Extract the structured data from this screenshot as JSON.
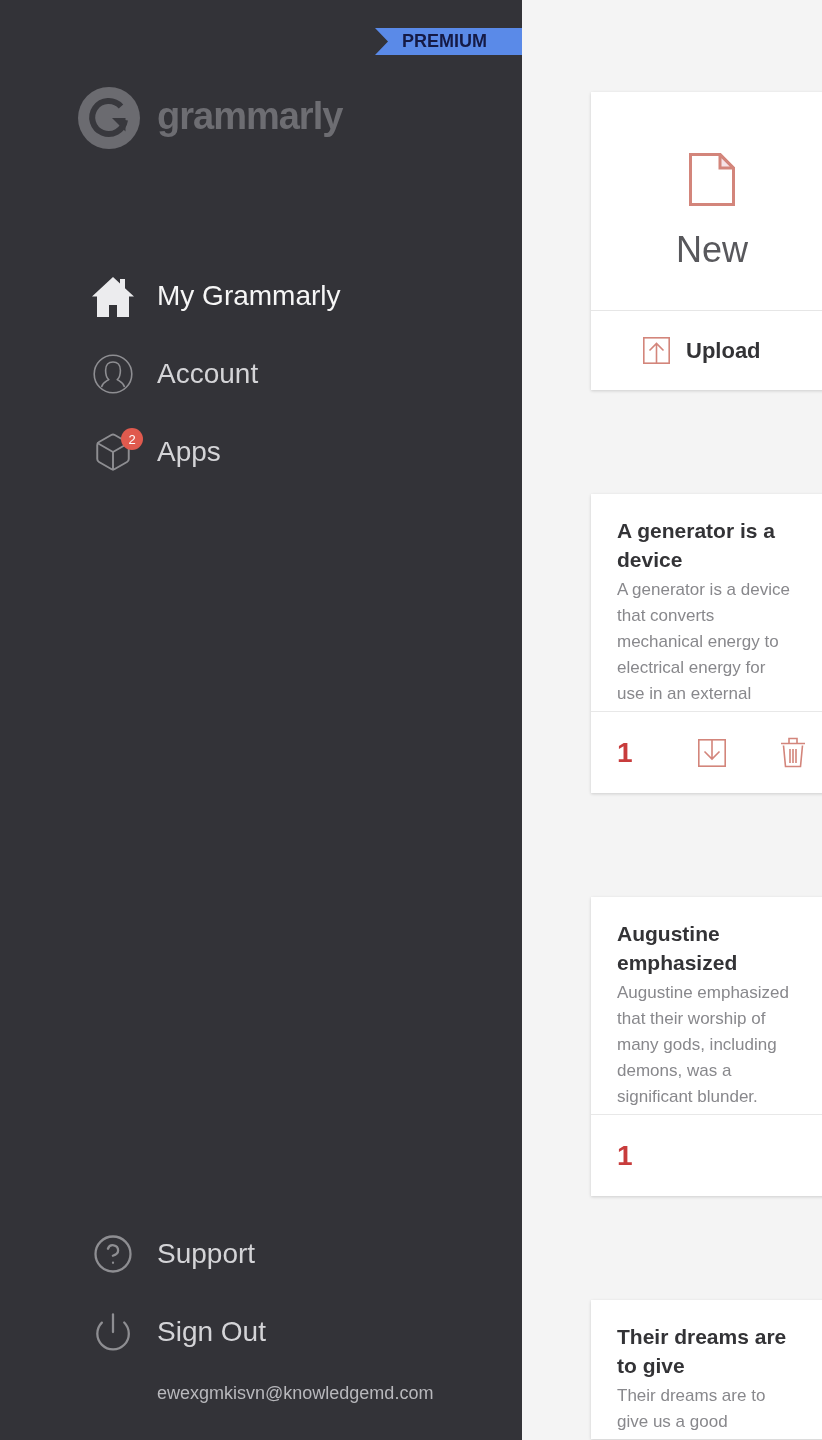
{
  "sidebar": {
    "ribbon": "PREMIUM",
    "logo_text": "grammarly",
    "nav": [
      {
        "label": "My Grammarly",
        "selected": true
      },
      {
        "label": "Account",
        "selected": false
      },
      {
        "label": "Apps",
        "selected": false,
        "badge": "2"
      }
    ],
    "bottom_links": [
      {
        "label": "Support"
      },
      {
        "label": "Sign Out"
      }
    ],
    "user_email": "ewexgmkisvn@knowledgemd.com"
  },
  "main": {
    "new_card": {
      "new_label": "New",
      "upload_label": "Upload"
    },
    "documents": [
      {
        "title": "A generator is a device",
        "preview": "A generator is a device that converts mechanical energy to electrical energy for use in an external",
        "count": "1",
        "actions_shown": true
      },
      {
        "title": "Augustine emphasized",
        "preview": "Augustine emphasized that their worship of many gods, including demons, was a significant blunder.",
        "count": "1",
        "actions_shown": false
      },
      {
        "title": "Their dreams are to give",
        "preview": "Their dreams are to give us a good"
      }
    ]
  }
}
